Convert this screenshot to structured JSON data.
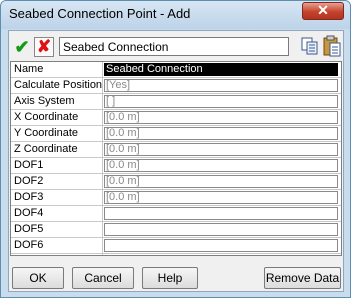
{
  "window": {
    "title": "Seabed Connection Point - Add"
  },
  "toolbar": {
    "name_value": "Seabed Connection"
  },
  "properties": [
    {
      "label": "Name",
      "value": "Seabed Connection",
      "selected": true
    },
    {
      "label": "Calculate Position",
      "value": "[Yes]"
    },
    {
      "label": "Axis System",
      "value": "[ ]"
    },
    {
      "label": "X Coordinate",
      "value": "[0.0 m]"
    },
    {
      "label": "Y Coordinate",
      "value": "[0.0 m]"
    },
    {
      "label": "Z Coordinate",
      "value": "[0.0 m]"
    },
    {
      "label": "DOF1",
      "value": "[0.0 m]"
    },
    {
      "label": "DOF2",
      "value": "[0.0 m]"
    },
    {
      "label": "DOF3",
      "value": "[0.0 m]"
    },
    {
      "label": "DOF4",
      "value": ""
    },
    {
      "label": "DOF5",
      "value": ""
    },
    {
      "label": "DOF6",
      "value": ""
    }
  ],
  "buttons": {
    "ok": "OK",
    "cancel": "Cancel",
    "help": "Help",
    "remove": "Remove Data"
  }
}
